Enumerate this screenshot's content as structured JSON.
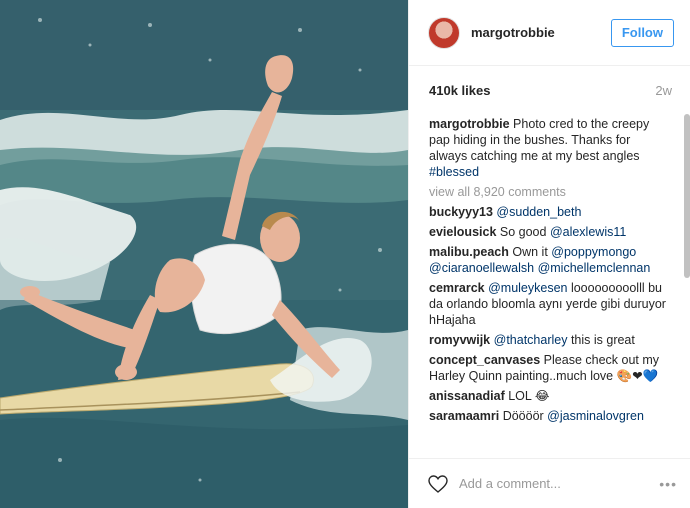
{
  "post": {
    "username": "margotrobbie",
    "follow_label": "Follow",
    "likes": "410k likes",
    "age": "2w",
    "photo_alt": "surfing-photo"
  },
  "caption": {
    "username": "margotrobbie",
    "text": "Photo cred to the creepy pap hiding in the bushes. Thanks for always catching me at my best angles ",
    "hashtag": "#blessed"
  },
  "view_all": "view all 8,920 comments",
  "comments": [
    {
      "user": "buckyyy13",
      "pre": "",
      "mention": "@sudden_beth",
      "post": ""
    },
    {
      "user": "evielousick",
      "pre": "So good ",
      "mention": "@alexlewis11",
      "post": ""
    },
    {
      "user": "malibu.peach",
      "pre": "Own it ",
      "mention": "@poppymongo @ciaranoellewalsh @michellemclennan",
      "post": ""
    },
    {
      "user": "cemrarck",
      "pre": "",
      "mention": "@muleykesen",
      "post": " looooooooolll bu da orlando bloomla aynı yerde gibi duruyor hHajaha"
    },
    {
      "user": "romyvwijk",
      "pre": "",
      "mention": "@thatcharley",
      "post": " this is great"
    },
    {
      "user": "concept_canvases",
      "pre": "Please check out my Harley Quinn painting..much love 🎨❤💙",
      "mention": "",
      "post": ""
    },
    {
      "user": "anissanadiaf",
      "pre": "LOL 😂",
      "mention": "",
      "post": ""
    },
    {
      "user": "saramaamri",
      "pre": "Döööör ",
      "mention": "@jasminalovgren",
      "post": ""
    }
  ],
  "footer": {
    "add_comment_placeholder": "Add a comment...",
    "more_label": "•••"
  },
  "icons": {
    "heart": "heart-icon",
    "more": "more-options-icon"
  },
  "colors": {
    "follow_blue": "#3897f0",
    "mention_blue": "#003569",
    "muted": "#999999"
  }
}
